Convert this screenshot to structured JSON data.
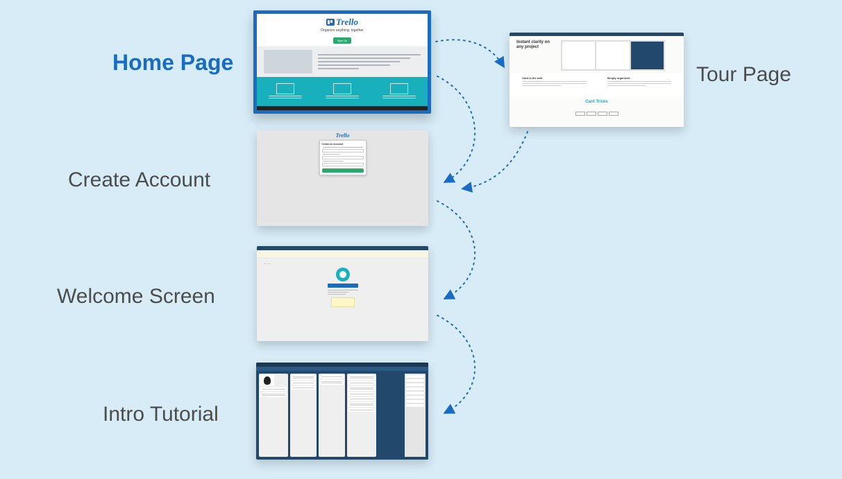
{
  "labels": {
    "home": "Home Page",
    "tour": "Tour Page",
    "create": "Create Account",
    "welcome": "Welcome Screen",
    "intro": "Intro Tutorial"
  },
  "home_thumb": {
    "logo_text": "Trello",
    "tagline": "Organize anything, together",
    "cta_label": "Sign Up"
  },
  "tour_thumb": {
    "hero_title": "Instant clarity on any project",
    "section_title": "Card Tricks",
    "feature_a": "Card is the web",
    "feature_b": "Simply organized"
  },
  "create_thumb": {
    "logo_text": "Trello",
    "form_title": "Create an Account"
  },
  "colors": {
    "background": "#d7ecf7",
    "accent_blue": "#1a6cc2",
    "teal": "#19b0bd",
    "navy": "#22486b",
    "green": "#2aa96f"
  }
}
